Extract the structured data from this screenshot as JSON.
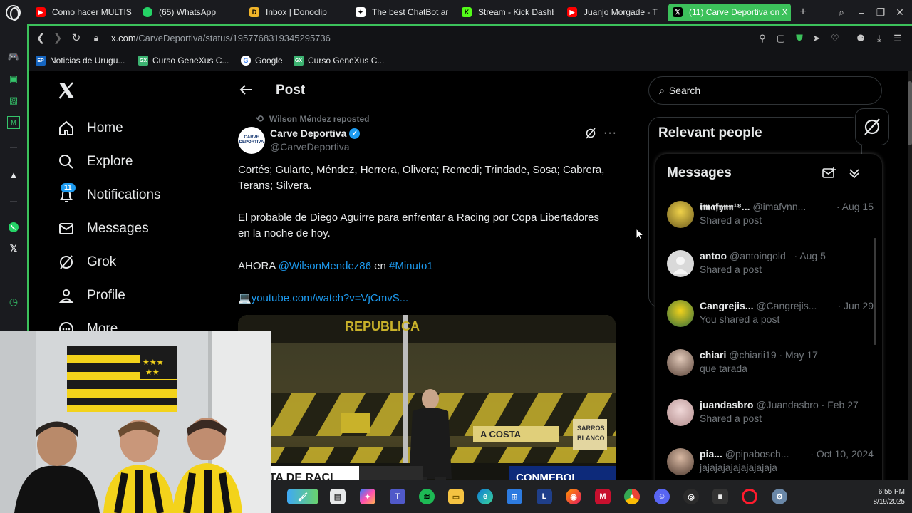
{
  "browser": {
    "tabs": [
      {
        "title": "Como hacer MULTIS",
        "icon": "youtube-icon",
        "color": "#ff0000"
      },
      {
        "title": "(65) WhatsApp",
        "icon": "whatsapp-icon",
        "color": "#25d366"
      },
      {
        "title": "Inbox | Donoclip",
        "icon": "donoclip-icon",
        "color": "#f0b429"
      },
      {
        "title": "The best ChatBot and",
        "icon": "chatbot-icon",
        "color": "#ffffff"
      },
      {
        "title": "Stream - Kick Dashb",
        "icon": "kick-icon",
        "color": "#53fc18"
      },
      {
        "title": "Juanjo Morgade - T",
        "icon": "youtube-icon",
        "color": "#ff0000"
      },
      {
        "title": "(11) Carve Deportiva on X",
        "icon": "x-icon",
        "color": "#000000",
        "active": true
      }
    ],
    "url_host": "x.com",
    "url_path": "/CarveDeportiva/status/1957768319345295736",
    "bookmarks": [
      {
        "label": "Noticias de Urugu...",
        "icon": "ep-icon",
        "color": "#1565c0",
        "abbr": "EP"
      },
      {
        "label": "Curso GeneXus C...",
        "icon": "genexus-icon",
        "color": "#3cb371",
        "abbr": "GX"
      },
      {
        "label": "Google",
        "icon": "google-icon",
        "color": "#ffffff",
        "abbr": "G"
      },
      {
        "label": "Curso GeneXus C...",
        "icon": "genexus-icon",
        "color": "#3cb371",
        "abbr": "GX"
      }
    ],
    "accent": "#3cc15b"
  },
  "nav": {
    "items": [
      {
        "label": "Home",
        "icon": "home-icon"
      },
      {
        "label": "Explore",
        "icon": "search-icon"
      },
      {
        "label": "Notifications",
        "icon": "bell-icon"
      },
      {
        "label": "Messages",
        "icon": "mail-icon"
      },
      {
        "label": "Grok",
        "icon": "grok-icon"
      },
      {
        "label": "Profile",
        "icon": "person-icon"
      },
      {
        "label": "More",
        "icon": "more-icon"
      }
    ],
    "notifications_count": "11"
  },
  "post": {
    "header": "Post",
    "reposted_by": "Wilson Méndez reposted",
    "author": "Carve Deportiva",
    "handle": "@CarveDeportiva",
    "avatar_text": "CARVE DEPORTIVA",
    "line1": "Cortés; Gularte, Méndez, Herrera, Olivera; Remedi; Trindade, Sosa; Cabrera, Terans; Silvera.",
    "line2": "El probable de Diego Aguirre para enfrentar a Racing por Copa Libertadores en la noche de hoy.",
    "line3_prefix": "AHORA",
    "mention": "@WilsonMendez86",
    "line3_mid": "en",
    "hashtag": "#Minuto1",
    "link_emoji": "💻",
    "link": "youtube.com/watch?v=VjCmvS...",
    "image_banners": [
      "BASTA DE RACI",
      "CONMEBOL",
      "SARROS",
      "BLANCO",
      "A COSTA",
      "REPUBLICA"
    ]
  },
  "right": {
    "search_placeholder": "Search",
    "relevant_title": "Relevant people",
    "messages_title": "Messages",
    "messages": [
      {
        "name": "𝖎𝖒𝖆𝖋𝖞𝖓𝖓¹⁸...",
        "handle": "@imafynn...",
        "date": "· Aug 15",
        "preview": "Shared a post",
        "avatar_color": "#c9a227"
      },
      {
        "name": "antoo",
        "handle": "@antoingold_",
        "date": "· Aug 5",
        "preview": "Shared a post",
        "avatar_color": "#d9d9d9"
      },
      {
        "name": "Cangrejis...",
        "handle": "@Cangrejis...",
        "date": "· Jun 29",
        "preview": "You shared a post",
        "avatar_color": "#e6c21a"
      },
      {
        "name": "chiari",
        "handle": "@chiarii19",
        "date": "· May 17",
        "preview": "que tarada",
        "avatar_color": "#9c7b6b"
      },
      {
        "name": "juandasbro",
        "handle": "@Juandasbro",
        "date": "· Feb 27",
        "preview": "Shared a post",
        "avatar_color": "#d6b5b5"
      },
      {
        "name": "pia...",
        "handle": "@pipabosch...",
        "date": "· Oct 10, 2024",
        "preview": "jajajajajajajajajaja",
        "avatar_color": "#8a6a55"
      }
    ]
  },
  "taskbar": {
    "icons": [
      "paint-icon",
      "file-icon",
      "copilot-icon",
      "teams-icon",
      "spotify-icon",
      "folder-icon",
      "edge-icon",
      "store-icon",
      "l-app-icon",
      "firefox-icon",
      "mcafee-icon",
      "chrome-icon",
      "discord-icon",
      "obs-icon",
      "webcam-app-icon",
      "opera-icon",
      "settings-icon"
    ],
    "time": "6:55 PM",
    "date": "8/19/2025"
  }
}
